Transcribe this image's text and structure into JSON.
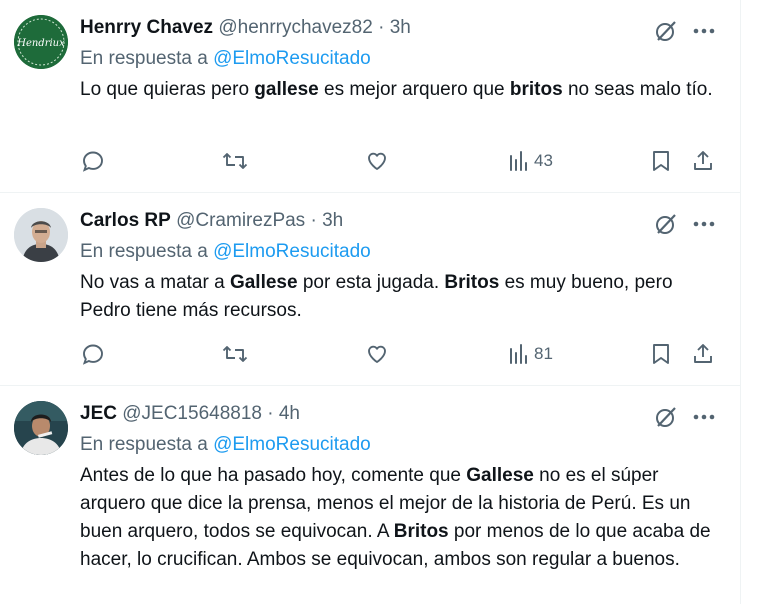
{
  "reply_prefix": "En respuesta a",
  "tweets": [
    {
      "display_name": "Henrry Chavez",
      "handle": "@henrrychavez82",
      "sep": "·",
      "time": "3h",
      "reply_to": "@ElmoResucitado",
      "avatar_text": "Hendriux",
      "body": [
        {
          "t": "Lo que quieras pero ",
          "b": false
        },
        {
          "t": "gallese",
          "b": true
        },
        {
          "t": " es mejor arquero que ",
          "b": false
        },
        {
          "t": "britos",
          "b": true
        },
        {
          "t": " no seas malo tío.",
          "b": false
        }
      ],
      "views": "43"
    },
    {
      "display_name": "Carlos RP",
      "handle": "@CramirezPas",
      "sep": "·",
      "time": "3h",
      "reply_to": "@ElmoResucitado",
      "body": [
        {
          "t": "No vas a matar a ",
          "b": false
        },
        {
          "t": "Gallese",
          "b": true
        },
        {
          "t": " por esta jugada. ",
          "b": false
        },
        {
          "t": "Britos",
          "b": true
        },
        {
          "t": " es muy bueno, pero Pedro tiene más recursos.",
          "b": false
        }
      ],
      "views": "81"
    },
    {
      "display_name": "JEC",
      "handle": "@JEC15648818",
      "sep": "·",
      "time": "4h",
      "reply_to": "@ElmoResucitado",
      "body": [
        {
          "t": "Antes de lo que ha pasado hoy, comente que ",
          "b": false
        },
        {
          "t": "Gallese",
          "b": true
        },
        {
          "t": " no es el súper arquero que dice la prensa, menos el mejor de la historia de Perú. Es un buen arquero, todos se equivocan. A ",
          "b": false
        },
        {
          "t": "Britos",
          "b": true
        },
        {
          "t": " por menos de lo que acaba de hacer, lo crucifican. Ambos se equivocan, ambos son regular a buenos.",
          "b": false
        }
      ]
    }
  ],
  "colors": {
    "accent": "#1d9bf0",
    "text": "#0f1419",
    "muted": "#536471",
    "border": "#eff3f4"
  }
}
